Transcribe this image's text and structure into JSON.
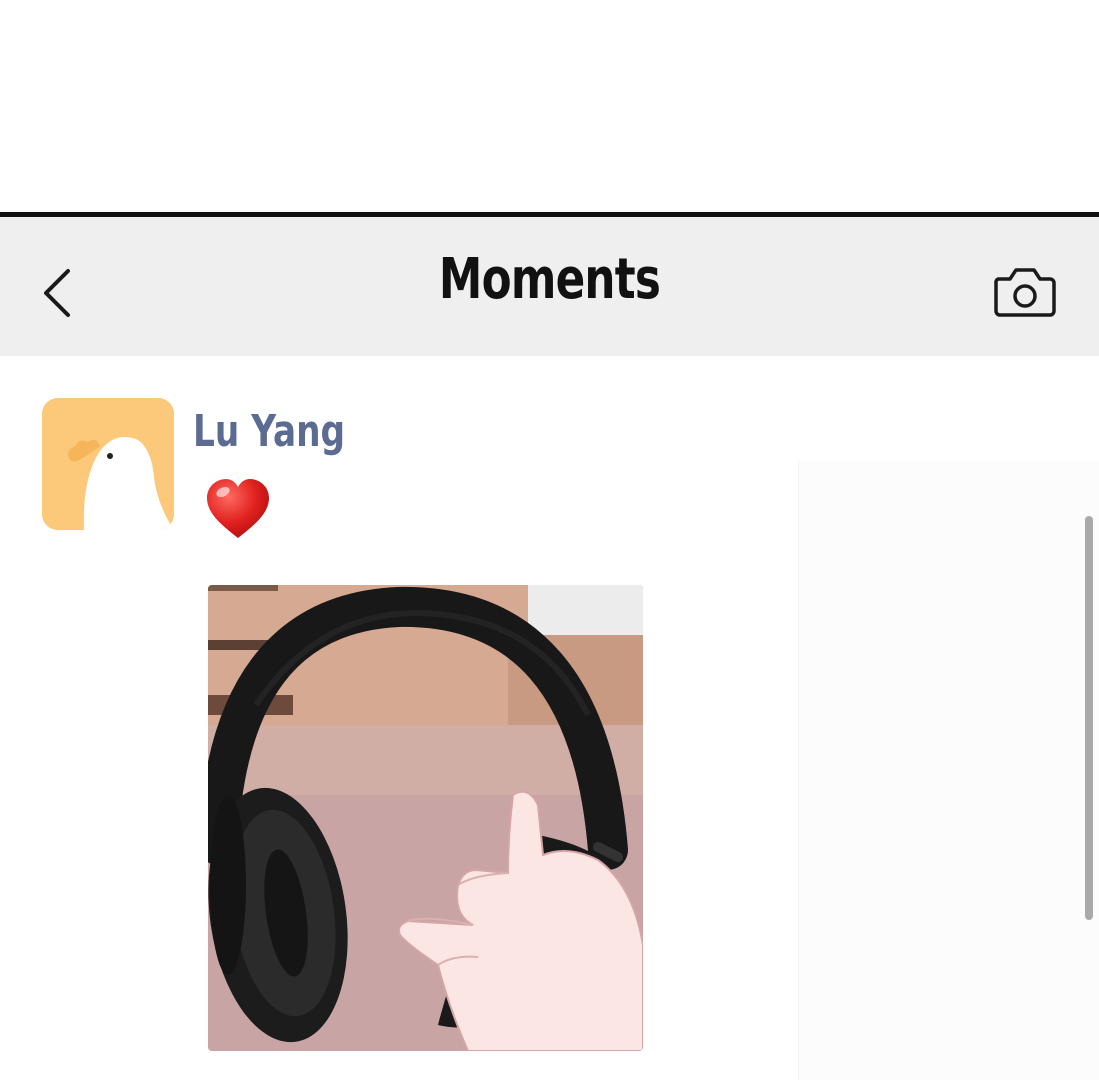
{
  "header": {
    "title": "Moments",
    "back_icon": "chevron-left-icon",
    "camera_icon": "camera-icon"
  },
  "post": {
    "author": "Lu Yang",
    "text_emoji": "heart-emoji",
    "avatar": "chick-avatar",
    "image": "headphones-illustration"
  },
  "colors": {
    "nav_background": "#efefef",
    "author_name": "#5b6b92",
    "avatar_background": "#fcc97a",
    "heart": "#e0211f"
  }
}
